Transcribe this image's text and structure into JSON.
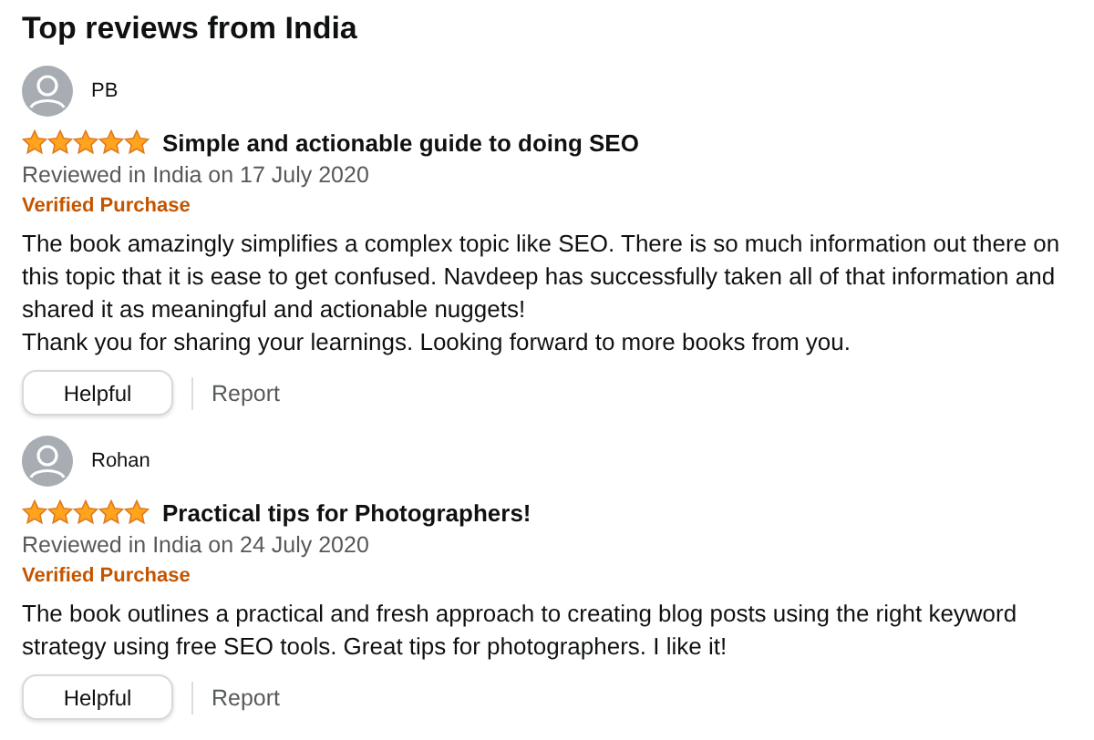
{
  "heading": "Top reviews from India",
  "reviews": [
    {
      "author": "PB",
      "stars": 5,
      "title": "Simple and actionable guide to doing SEO",
      "date": "Reviewed in India on 17 July 2020",
      "badge": "Verified Purchase",
      "body": [
        "The book amazingly simplifies a complex topic like SEO. There is so much information out there on this topic that it is ease to get confused. Navdeep has successfully taken all of that information and shared it as meaningful and actionable nuggets!",
        "Thank you for sharing your learnings. Looking forward to more books from you."
      ],
      "helpful": "Helpful",
      "report": "Report"
    },
    {
      "author": "Rohan",
      "stars": 5,
      "title": "Practical tips for Photographers!",
      "date": "Reviewed in India on 24 July 2020",
      "badge": "Verified Purchase",
      "body": [
        "The book outlines a practical and fresh approach to creating blog posts using the right keyword strategy using free SEO tools. Great tips for photographers. I like it!"
      ],
      "helpful": "Helpful",
      "report": "Report"
    }
  ]
}
